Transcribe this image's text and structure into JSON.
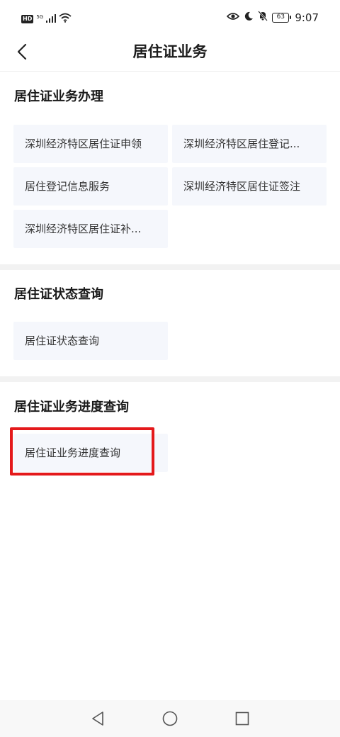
{
  "status_bar": {
    "hd_label": "HD",
    "network_label": "5G",
    "battery_level": "63",
    "time": "9:07"
  },
  "header": {
    "title": "居住证业务"
  },
  "sections": [
    {
      "title": "居住证业务办理",
      "items": [
        "深圳经济特区居住证申领",
        "深圳经济特区居住登记...",
        "居住登记信息服务",
        "深圳经济特区居住证签注",
        "深圳经济特区居住证补..."
      ]
    },
    {
      "title": "居住证状态查询",
      "items": [
        "居住证状态查询"
      ]
    },
    {
      "title": "居住证业务进度查询",
      "items": [
        "居住证业务进度查询"
      ]
    }
  ],
  "highlight_color": "#e4191b",
  "button_background": "#f5f7fc",
  "icons": {
    "back": "chevron-left-icon",
    "eye": "eye-icon",
    "moon": "moon-icon",
    "mute": "bell-off-icon",
    "wifi": "wifi-icon",
    "signal": "signal-icon",
    "nav_back": "triangle-back-icon",
    "nav_home": "circle-home-icon",
    "nav_recent": "square-recent-icon"
  }
}
